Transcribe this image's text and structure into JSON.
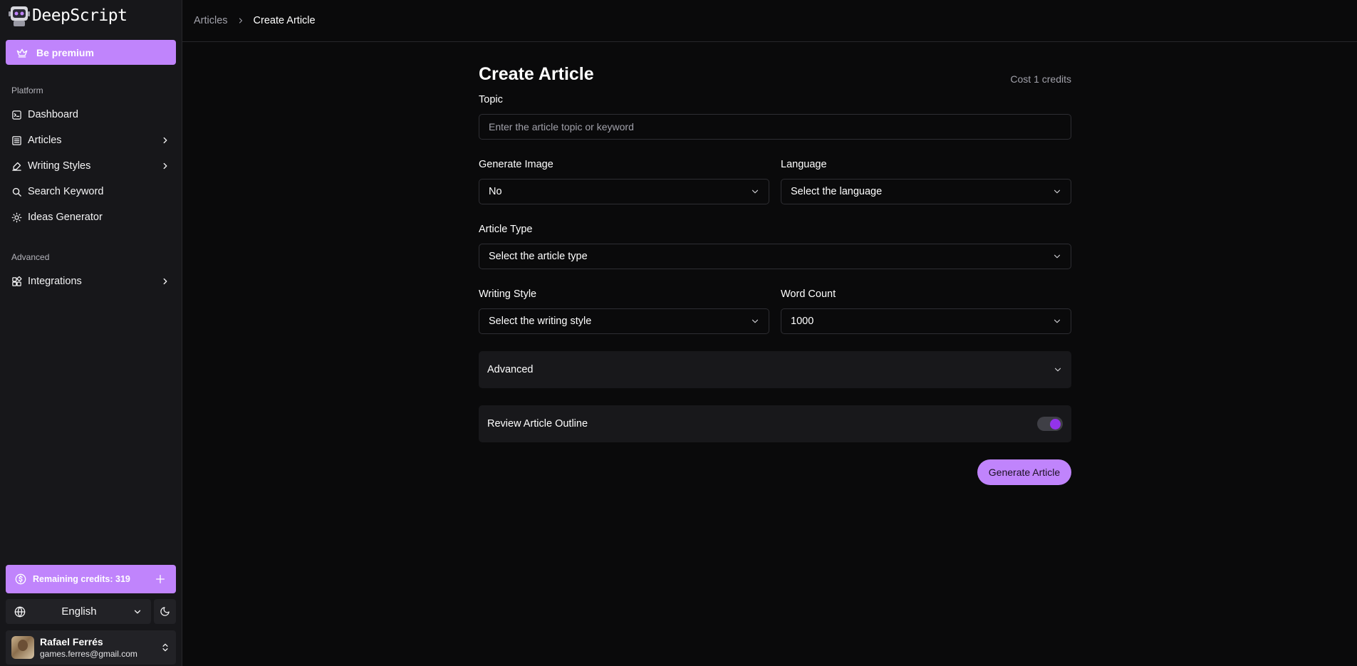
{
  "app": {
    "name": "DeepScript"
  },
  "sidebar": {
    "premium_label": "Be premium",
    "platform_label": "Platform",
    "platform_items": [
      {
        "label": "Dashboard",
        "icon": "terminal-icon",
        "has_submenu": false
      },
      {
        "label": "Articles",
        "icon": "list-icon",
        "has_submenu": true
      },
      {
        "label": "Writing Styles",
        "icon": "pen-icon",
        "has_submenu": true
      },
      {
        "label": "Search Keyword",
        "icon": "search-icon",
        "has_submenu": false
      },
      {
        "label": "Ideas Generator",
        "icon": "lightbulb-icon",
        "has_submenu": false
      }
    ],
    "advanced_label": "Advanced",
    "advanced_items": [
      {
        "label": "Integrations",
        "icon": "blocks-icon",
        "has_submenu": true
      }
    ],
    "credits_label": "Remaining credits: 319",
    "language": "English",
    "user": {
      "name": "Rafael Ferrés",
      "email": "games.ferres@gmail.com"
    }
  },
  "breadcrumb": {
    "parent": "Articles",
    "current": "Create Article"
  },
  "form": {
    "title": "Create Article",
    "cost": "Cost 1 credits",
    "topic": {
      "label": "Topic",
      "placeholder": "Enter the article topic or keyword",
      "value": ""
    },
    "generate_image": {
      "label": "Generate Image",
      "value": "No"
    },
    "language": {
      "label": "Language",
      "value": "Select the language"
    },
    "article_type": {
      "label": "Article Type",
      "value": "Select the article type"
    },
    "writing_style": {
      "label": "Writing Style",
      "value": "Select the writing style"
    },
    "word_count": {
      "label": "Word Count",
      "value": "1000"
    },
    "advanced_label": "Advanced",
    "review_outline": {
      "label": "Review Article Outline",
      "enabled": true
    },
    "submit_label": "Generate Article"
  },
  "colors": {
    "accent": "#c084fc",
    "toggle_knob": "#9333ea",
    "background": "#0a0a0b",
    "sidebar": "#17171a"
  }
}
